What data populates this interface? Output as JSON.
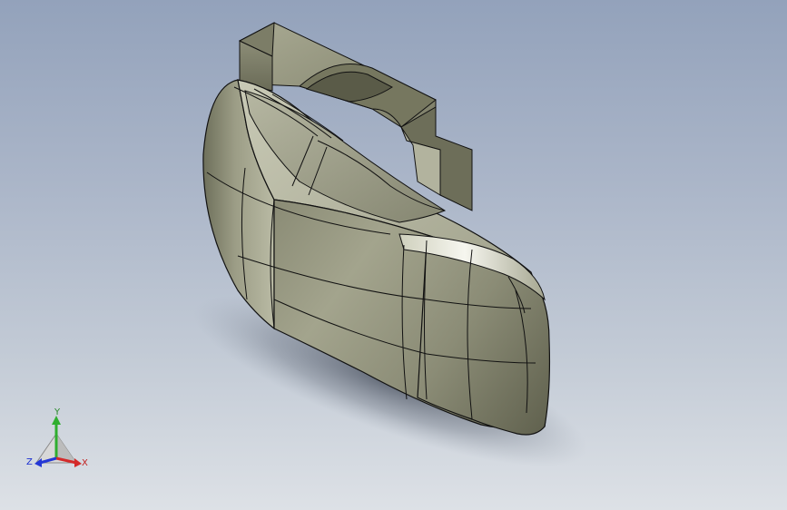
{
  "viewport": {
    "background_top": "#93a2bb",
    "background_bottom": "#dde1e6"
  },
  "model": {
    "shade_dark": "#5d5f4c",
    "shade_mid": "#8f907a",
    "shade_light": "#c5c6b1",
    "highlight": "#f4f4ec",
    "edge_color": "#111111"
  },
  "triad": {
    "x_label": "X",
    "y_label": "Y",
    "z_label": "Z",
    "x_color": "#d42a2a",
    "y_color": "#2fae2f",
    "z_color": "#2437d6",
    "icon": "reference-triad-icon"
  }
}
